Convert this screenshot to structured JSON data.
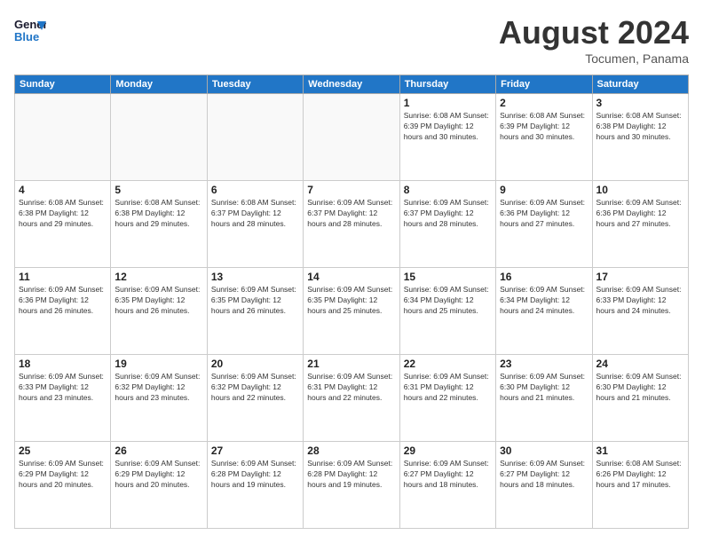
{
  "header": {
    "logo_line1": "General",
    "logo_line2": "Blue",
    "month_year": "August 2024",
    "location": "Tocumen, Panama"
  },
  "days_of_week": [
    "Sunday",
    "Monday",
    "Tuesday",
    "Wednesday",
    "Thursday",
    "Friday",
    "Saturday"
  ],
  "weeks": [
    [
      {
        "day": "",
        "info": ""
      },
      {
        "day": "",
        "info": ""
      },
      {
        "day": "",
        "info": ""
      },
      {
        "day": "",
        "info": ""
      },
      {
        "day": "1",
        "info": "Sunrise: 6:08 AM\nSunset: 6:39 PM\nDaylight: 12 hours\nand 30 minutes."
      },
      {
        "day": "2",
        "info": "Sunrise: 6:08 AM\nSunset: 6:39 PM\nDaylight: 12 hours\nand 30 minutes."
      },
      {
        "day": "3",
        "info": "Sunrise: 6:08 AM\nSunset: 6:38 PM\nDaylight: 12 hours\nand 30 minutes."
      }
    ],
    [
      {
        "day": "4",
        "info": "Sunrise: 6:08 AM\nSunset: 6:38 PM\nDaylight: 12 hours\nand 29 minutes."
      },
      {
        "day": "5",
        "info": "Sunrise: 6:08 AM\nSunset: 6:38 PM\nDaylight: 12 hours\nand 29 minutes."
      },
      {
        "day": "6",
        "info": "Sunrise: 6:08 AM\nSunset: 6:37 PM\nDaylight: 12 hours\nand 28 minutes."
      },
      {
        "day": "7",
        "info": "Sunrise: 6:09 AM\nSunset: 6:37 PM\nDaylight: 12 hours\nand 28 minutes."
      },
      {
        "day": "8",
        "info": "Sunrise: 6:09 AM\nSunset: 6:37 PM\nDaylight: 12 hours\nand 28 minutes."
      },
      {
        "day": "9",
        "info": "Sunrise: 6:09 AM\nSunset: 6:36 PM\nDaylight: 12 hours\nand 27 minutes."
      },
      {
        "day": "10",
        "info": "Sunrise: 6:09 AM\nSunset: 6:36 PM\nDaylight: 12 hours\nand 27 minutes."
      }
    ],
    [
      {
        "day": "11",
        "info": "Sunrise: 6:09 AM\nSunset: 6:36 PM\nDaylight: 12 hours\nand 26 minutes."
      },
      {
        "day": "12",
        "info": "Sunrise: 6:09 AM\nSunset: 6:35 PM\nDaylight: 12 hours\nand 26 minutes."
      },
      {
        "day": "13",
        "info": "Sunrise: 6:09 AM\nSunset: 6:35 PM\nDaylight: 12 hours\nand 26 minutes."
      },
      {
        "day": "14",
        "info": "Sunrise: 6:09 AM\nSunset: 6:35 PM\nDaylight: 12 hours\nand 25 minutes."
      },
      {
        "day": "15",
        "info": "Sunrise: 6:09 AM\nSunset: 6:34 PM\nDaylight: 12 hours\nand 25 minutes."
      },
      {
        "day": "16",
        "info": "Sunrise: 6:09 AM\nSunset: 6:34 PM\nDaylight: 12 hours\nand 24 minutes."
      },
      {
        "day": "17",
        "info": "Sunrise: 6:09 AM\nSunset: 6:33 PM\nDaylight: 12 hours\nand 24 minutes."
      }
    ],
    [
      {
        "day": "18",
        "info": "Sunrise: 6:09 AM\nSunset: 6:33 PM\nDaylight: 12 hours\nand 23 minutes."
      },
      {
        "day": "19",
        "info": "Sunrise: 6:09 AM\nSunset: 6:32 PM\nDaylight: 12 hours\nand 23 minutes."
      },
      {
        "day": "20",
        "info": "Sunrise: 6:09 AM\nSunset: 6:32 PM\nDaylight: 12 hours\nand 22 minutes."
      },
      {
        "day": "21",
        "info": "Sunrise: 6:09 AM\nSunset: 6:31 PM\nDaylight: 12 hours\nand 22 minutes."
      },
      {
        "day": "22",
        "info": "Sunrise: 6:09 AM\nSunset: 6:31 PM\nDaylight: 12 hours\nand 22 minutes."
      },
      {
        "day": "23",
        "info": "Sunrise: 6:09 AM\nSunset: 6:30 PM\nDaylight: 12 hours\nand 21 minutes."
      },
      {
        "day": "24",
        "info": "Sunrise: 6:09 AM\nSunset: 6:30 PM\nDaylight: 12 hours\nand 21 minutes."
      }
    ],
    [
      {
        "day": "25",
        "info": "Sunrise: 6:09 AM\nSunset: 6:29 PM\nDaylight: 12 hours\nand 20 minutes."
      },
      {
        "day": "26",
        "info": "Sunrise: 6:09 AM\nSunset: 6:29 PM\nDaylight: 12 hours\nand 20 minutes."
      },
      {
        "day": "27",
        "info": "Sunrise: 6:09 AM\nSunset: 6:28 PM\nDaylight: 12 hours\nand 19 minutes."
      },
      {
        "day": "28",
        "info": "Sunrise: 6:09 AM\nSunset: 6:28 PM\nDaylight: 12 hours\nand 19 minutes."
      },
      {
        "day": "29",
        "info": "Sunrise: 6:09 AM\nSunset: 6:27 PM\nDaylight: 12 hours\nand 18 minutes."
      },
      {
        "day": "30",
        "info": "Sunrise: 6:09 AM\nSunset: 6:27 PM\nDaylight: 12 hours\nand 18 minutes."
      },
      {
        "day": "31",
        "info": "Sunrise: 6:08 AM\nSunset: 6:26 PM\nDaylight: 12 hours\nand 17 minutes."
      }
    ]
  ]
}
